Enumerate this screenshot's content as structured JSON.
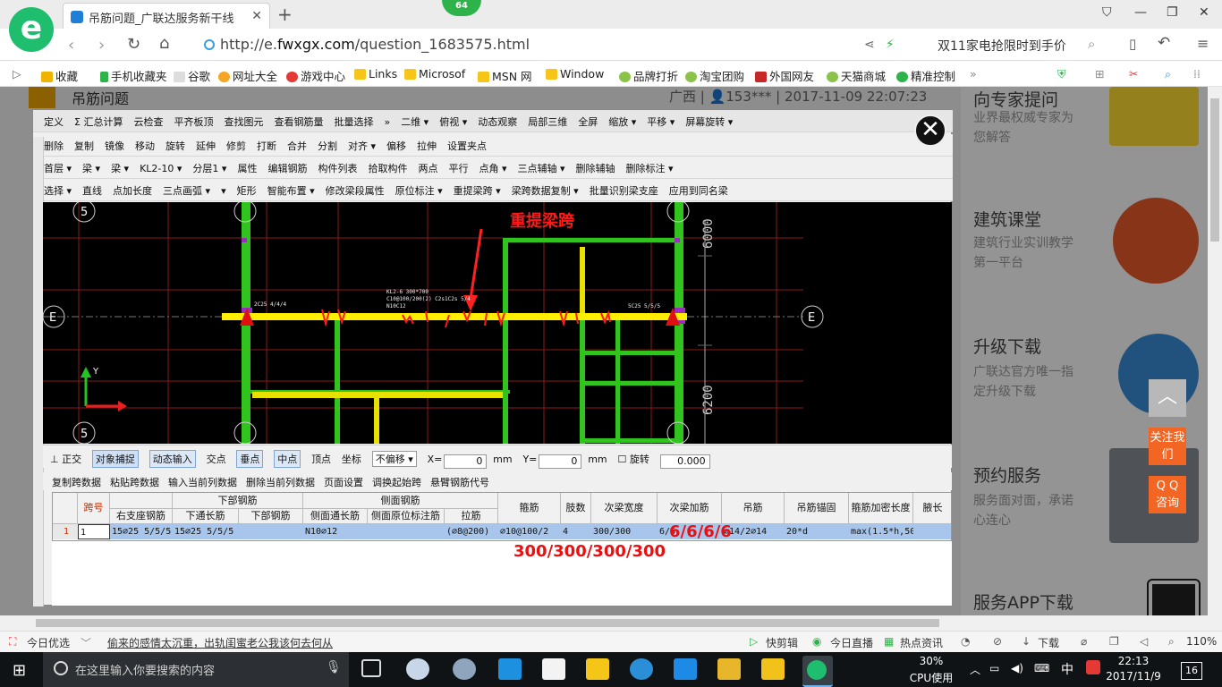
{
  "browser": {
    "tab_title": "吊筋问题_广联达服务新干线",
    "tab_close": "✕",
    "new_tab": "+",
    "badge": "64",
    "url_prefix": "http://e.",
    "url_domain": "fwxgx.com",
    "url_path": "/question_1683575.html",
    "search_hint": "双11家电抢限时到手价",
    "bookmarks": [
      "收藏",
      "手机收藏夹",
      "谷歌",
      "网址大全",
      "游戏中心",
      "Links",
      "Microsof",
      "MSN 网",
      "Window",
      "品牌打折",
      "淘宝团购",
      "外国网友",
      "天猫商城",
      "精准控制"
    ],
    "bookmarks_more": "»"
  },
  "page": {
    "title": "吊筋问题",
    "meta": "广西 | 👤153*** | 2017-11-09 22:07:23",
    "side": [
      {
        "title": "向专家提问",
        "desc": "业界最权威专家为您解答"
      },
      {
        "title": "建筑课堂",
        "desc": "建筑行业实训教学第一平台"
      },
      {
        "title": "升级下载",
        "desc": "广联达官方唯一指定升级下载"
      },
      {
        "title": "预约服务",
        "desc": "服务面对面，承诺心连心"
      },
      {
        "title": "服务APP下载",
        "desc": ""
      }
    ],
    "float_follow": "关注我们",
    "float_qq": "Q Q\n咨询"
  },
  "software": {
    "toolbar1": [
      "定义",
      "Σ 汇总计算",
      "云检查",
      "平齐板顶",
      "查找图元",
      "查看钢筋量",
      "批量选择",
      "»",
      "二维 ▾",
      "俯视 ▾",
      "动态观察",
      "局部三维",
      "全屏",
      "缩放 ▾",
      "平移 ▾",
      "屏幕旋转 ▾"
    ],
    "toolbar2": [
      "删除",
      "复制",
      "镜像",
      "移动",
      "旋转",
      "延伸",
      "修剪",
      "打断",
      "合并",
      "分割",
      "对齐 ▾",
      "偏移",
      "拉伸",
      "设置夹点"
    ],
    "toolbar3": [
      "首层 ▾",
      "梁 ▾",
      "梁 ▾",
      "KL2-10 ▾",
      "分层1 ▾",
      "属性",
      "编辑钢筋",
      "构件列表",
      "拾取构件",
      "两点",
      "平行",
      "点角 ▾",
      "三点辅轴 ▾",
      "删除辅轴",
      "删除标注 ▾"
    ],
    "toolbar4": [
      "选择 ▾",
      "直线",
      "点加长度",
      "三点画弧 ▾",
      "▾",
      "矩形",
      "智能布置 ▾",
      "修改梁段属性",
      "原位标注 ▾",
      "重提梁跨 ▾",
      "梁跨数据复制 ▾",
      "批量识别梁支座",
      "应用到同名梁"
    ],
    "snapbar": [
      "正交",
      "对象捕捉",
      "动态输入",
      "交点",
      "垂点",
      "中点",
      "顶点",
      "坐标",
      "不偏移 ▾",
      "X=",
      "mm",
      "Y=",
      "mm",
      "旋转"
    ],
    "snap_x": "0",
    "snap_y": "0",
    "snap_rot": "0.000",
    "tablebar": [
      "复制跨数据",
      "粘贴跨数据",
      "输入当前列数据",
      "删除当前列数据",
      "页面设置",
      "调换起始跨",
      "悬臂钢筋代号"
    ],
    "canvas": {
      "annotation": "重提梁跨",
      "axis_5": "5",
      "axis_e": "E",
      "dim_6000": "6000",
      "dim_6200": "6200",
      "axis_y": "Y"
    },
    "table": {
      "headers_top": [
        "跨号",
        "下部钢筋",
        "侧面钢筋",
        "箍筋",
        "肢数",
        "次梁宽度",
        "次梁加筋",
        "吊筋",
        "吊筋锚固",
        "箍筋加密长度",
        "腋长"
      ],
      "headers_sub": [
        "右支座钢筋",
        "下通长筋",
        "下部钢筋",
        "侧面通长筋",
        "侧面原位标注筋",
        "拉筋"
      ],
      "row": [
        "1",
        "1",
        "15⌀25 5/5/5",
        "15⌀25 5/5/5",
        "",
        "N10⌀12",
        "",
        "(⌀8@200)",
        "⌀10@100/2",
        "4",
        "300/300",
        "6/6",
        "⌀14/2⌀14",
        "20*d",
        "max(1.5*h,50",
        ""
      ]
    },
    "overlay_red_1": "300/300/300/300",
    "overlay_red_2": "6/6/6/6"
  },
  "statusbar": [
    "今日优选",
    "偷来的感情太沉重，出轨闺蜜老公我该何去何从",
    "快剪辑",
    "今日直播",
    "热点资讯",
    "下载",
    "110%"
  ],
  "taskbar": {
    "search_placeholder": "在这里输入你要搜索的内容",
    "cpu": "30%",
    "cpu_label": "CPU使用",
    "ime": "中",
    "time": "22:13",
    "date": "2017/11/9",
    "notify": "16"
  }
}
